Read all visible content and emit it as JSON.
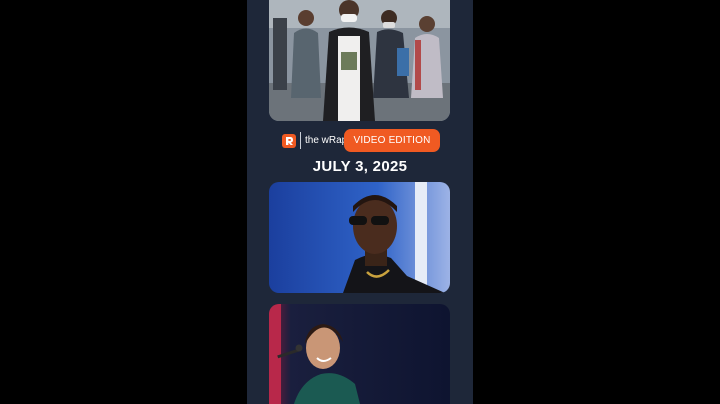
{
  "header": {
    "wrap_label": "the wRap",
    "edition_label": "VIDEO EDITION"
  },
  "main": {
    "date": "JULY 3, 2025"
  },
  "colors": {
    "background": "#000000",
    "frame": "#1e2739",
    "accent": "#f05a22"
  },
  "icons": {
    "logo": "rappler-logo-icon"
  }
}
